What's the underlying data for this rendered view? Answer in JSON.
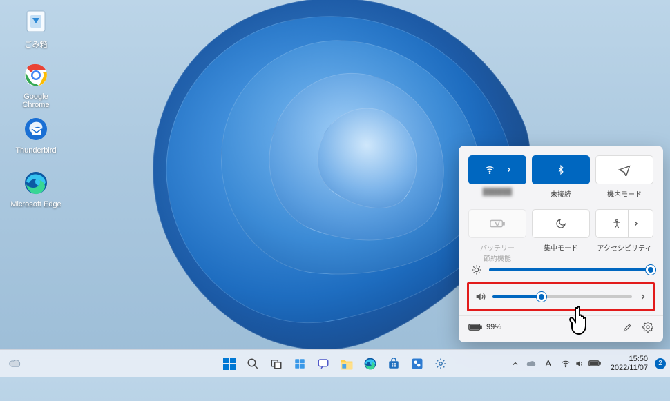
{
  "desktop_icons": [
    {
      "id": "recycle-bin",
      "label": "ごみ箱"
    },
    {
      "id": "chrome",
      "label": "Google Chrome"
    },
    {
      "id": "thunderbird",
      "label": "Thunderbird"
    },
    {
      "id": "edge",
      "label": "Microsoft Edge"
    }
  ],
  "quick_settings": {
    "tiles": [
      {
        "id": "wifi",
        "icon": "wifi-icon",
        "label_blurred": true,
        "label": "██████",
        "active": true,
        "has_arrow": true
      },
      {
        "id": "bluetooth",
        "icon": "bluetooth-icon",
        "label": "未接続",
        "active": true
      },
      {
        "id": "airplane",
        "icon": "airplane-icon",
        "label": "機内モード",
        "active": false
      },
      {
        "id": "battery-saver",
        "icon": "battery-saver-icon",
        "label": "バッテリー\n節約機能",
        "active": false,
        "disabled": true
      },
      {
        "id": "focus",
        "icon": "moon-icon",
        "label": "集中モード",
        "active": false
      },
      {
        "id": "accessibility",
        "icon": "accessibility-icon",
        "label": "アクセシビリティ",
        "active": false,
        "has_arrow": true
      }
    ],
    "brightness_pct": 100,
    "volume_pct": 35,
    "battery_text": "99%"
  },
  "taskbar": {
    "clock_time": "15:50",
    "clock_date": "2022/11/07",
    "notification_count": "2"
  }
}
